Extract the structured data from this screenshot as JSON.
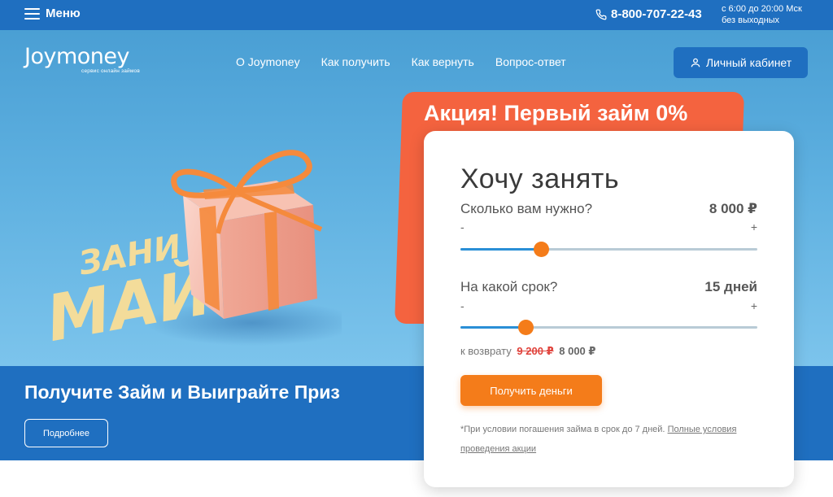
{
  "topbar": {
    "menu_label": "Меню",
    "phone": "8-800-707-22-43",
    "hours_line1": "с 6:00 до 20:00 Мск",
    "hours_line2": "без выходных"
  },
  "header": {
    "logo": "Joymoney",
    "logo_sub": "сервис онлайн займов",
    "nav": [
      "О Joymoney",
      "Как получить",
      "Как вернуть",
      "Вопрос-ответ"
    ],
    "cabinet_label": "Личный кабинет"
  },
  "hero": {
    "art_text_1": "ЗАНИ",
    "art_text_2": "МАЙ"
  },
  "promo": {
    "title": "Акция! Первый займ 0%"
  },
  "strip": {
    "title": "Получите Займ и Выиграйте Приз",
    "more_label": "Подробнее"
  },
  "calculator": {
    "title": "Хочу занять",
    "amount_label": "Сколько вам нужно?",
    "amount_value": "8 000 ₽",
    "amount_fraction": 0.27,
    "term_label": "На какой срок?",
    "term_value": "15 дней",
    "term_fraction": 0.22,
    "minus": "-",
    "plus": "+",
    "return_label": "к возврату",
    "return_old": "9 200 ₽",
    "return_new": "8 000 ₽",
    "submit_label": "Получить деньги",
    "note_text": "*При условии погашения займа в срок до 7 дней.",
    "note_link": "Полные условия проведения акции"
  },
  "colors": {
    "brand_blue": "#1f6fc0",
    "accent_orange": "#f47c1a",
    "promo_red": "#f4633f",
    "slider_blue": "#2a8fd6"
  }
}
